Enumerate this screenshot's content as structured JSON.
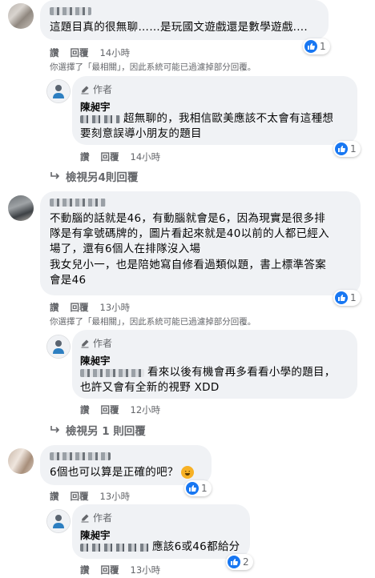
{
  "comments": [
    {
      "text_lines": [
        "這題目真的很無聊……是玩國文遊戲還是數學遊戲...."
      ],
      "reaction_count": "1",
      "actions": {
        "like": "讚",
        "reply": "回覆",
        "time": "14小時"
      },
      "filter_notice": "你選擇了「最相關」，因此系統可能已過濾掉部分回覆。",
      "reply": {
        "author_label": "作者",
        "author_name": "陳昶宇",
        "text_lines": [
          "超無聊的，我相信歐美應該不太會有這種想",
          "要刻意誤導小朋友的題目"
        ],
        "reaction_count": "1",
        "actions": {
          "like": "讚",
          "reply": "回覆",
          "time": "14小時"
        }
      },
      "more_replies": "檢視另4則回覆"
    },
    {
      "text_lines": [
        "不動腦的話就是46，有動腦就會是6，因為現實是很多排",
        "隊是有拿號碼牌的，圖片看起來就是40以前的人都已經入",
        "場了，還有6個人在排隊沒入場",
        "我女兒小一，也是陪她寫自修看過類似題，書上標準答案",
        "會是46"
      ],
      "reaction_count": "1",
      "actions": {
        "like": "讚",
        "reply": "回覆",
        "time": "13小時"
      },
      "filter_notice": "你選擇了「最相關」，因此系統可能已過濾掉部分回覆。",
      "reply": {
        "author_label": "作者",
        "author_name": "陳昶宇",
        "text_lines": [
          "看來以後有機會再多看看小學的題目，",
          "也許又會有全新的視野 XDD"
        ],
        "actions": {
          "like": "讚",
          "reply": "回覆",
          "time": "12小時"
        }
      },
      "more_replies": "檢視另 1 則回覆"
    },
    {
      "text_lines": [
        "6個也可以算是正確的吧？"
      ],
      "reaction_count": "1",
      "actions": {
        "like": "讚",
        "reply": "回覆",
        "time": "13小時"
      },
      "reply": {
        "author_label": "作者",
        "author_name": "陳昶宇",
        "text_lines": [
          "應該6或46都給分"
        ],
        "reaction_count": "2",
        "actions": {
          "like": "讚",
          "reply": "回覆",
          "time": "13小時"
        }
      }
    }
  ],
  "colors": {
    "bubble": "#f0f2f5",
    "like_blue": "#1877f2",
    "meta_gray": "#65676b"
  }
}
